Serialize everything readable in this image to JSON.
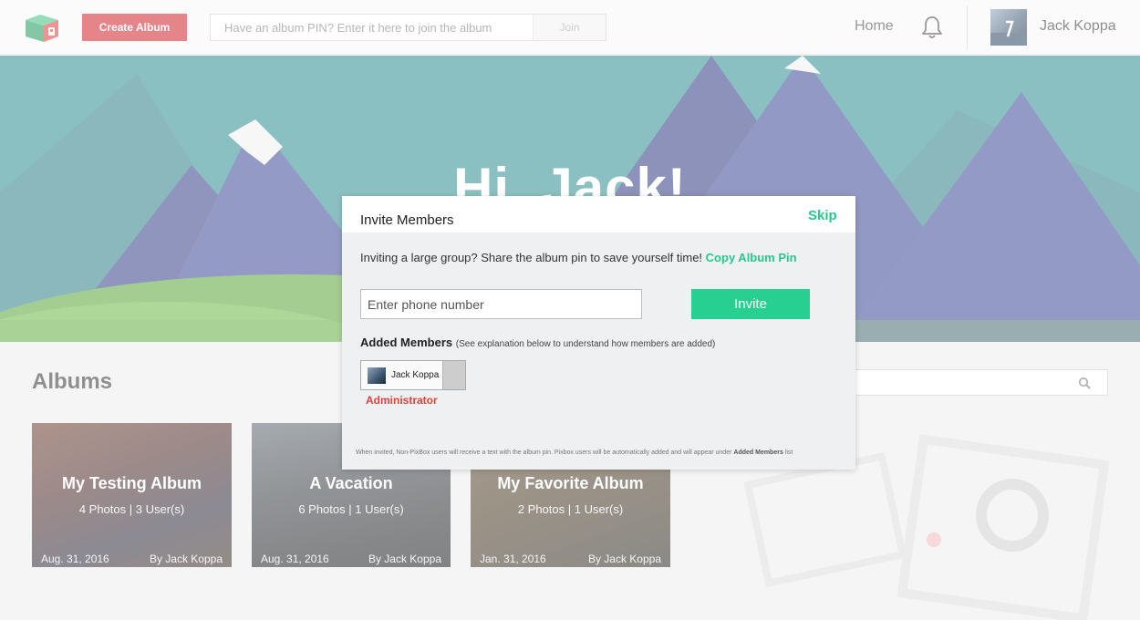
{
  "header": {
    "create_album_label": "Create Album",
    "pin_placeholder": "Have an album PIN? Enter it here to join the album",
    "join_label": "Join",
    "nav_home": "Home",
    "user_name": "Jack Koppa"
  },
  "hero": {
    "greeting": "Hi, Jack!"
  },
  "albums": {
    "heading": "Albums",
    "cards": [
      {
        "title": "My Testing Album",
        "meta": "4 Photos | 3 User(s)",
        "date": "Aug. 31, 2016",
        "by": "By Jack Koppa"
      },
      {
        "title": "A Vacation",
        "meta": "6 Photos | 1 User(s)",
        "date": "Aug. 31, 2016",
        "by": "By Jack Koppa"
      },
      {
        "title": "My Favorite Album",
        "meta": "2 Photos | 1 User(s)",
        "date": "Jan. 31, 2016",
        "by": "By Jack Koppa"
      }
    ]
  },
  "modal": {
    "title": "Invite Members",
    "skip_label": "Skip",
    "invite_text": "Inviting a large group? Share the album pin to save yourself time!",
    "copy_pin_label": "Copy Album Pin",
    "phone_placeholder": "Enter phone number",
    "invite_label": "Invite",
    "added_members_label": "Added Members",
    "added_members_note": "(See explanation below to understand how members are added)",
    "member_name": "Jack Koppa",
    "member_role": "Administrator",
    "footnote_text": "When invited, Non-PixBox users will receive a text with the album pin. Pixbox users will be automatically added and will appear under",
    "footnote_bold": "Added Members",
    "footnote_end": "list"
  },
  "colors": {
    "brand_red": "#d0212b",
    "accent_green": "#27d090",
    "admin_red": "#e0403a"
  }
}
